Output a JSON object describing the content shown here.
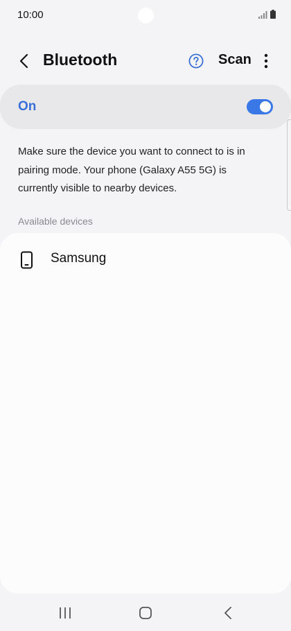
{
  "status_bar": {
    "time": "10:00"
  },
  "header": {
    "title": "Bluetooth",
    "scan_label": "Scan"
  },
  "toggle": {
    "label": "On",
    "state": "on",
    "accent_color": "#3b78e7"
  },
  "info_text": "Make sure the device you want to connect to is in pairing mode. Your phone (Galaxy A55 5G) is currently visible to nearby devices.",
  "available": {
    "header": "Available devices",
    "devices": [
      {
        "name": "Samsung",
        "icon": "phone-icon"
      }
    ]
  },
  "icons": [
    "back-arrow-icon",
    "help-icon",
    "more-options-icon",
    "signal-icon",
    "battery-icon",
    "recent-apps-icon",
    "home-icon",
    "nav-back-icon"
  ]
}
